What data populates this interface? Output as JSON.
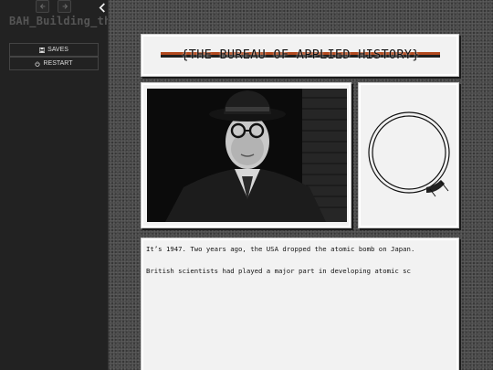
{
  "sidebar": {
    "title": "BAH_Building_the",
    "back_icon": "arrow-left-icon",
    "forward_icon": "arrow-right-icon",
    "collapse_icon": "chevron-left-icon",
    "buttons": {
      "saves": {
        "label": "SAVES",
        "icon": "floppy-disk-icon"
      },
      "restart": {
        "label": "RESTART",
        "icon": "power-icon"
      }
    }
  },
  "header": {
    "banner_text": "{THE BUREAU OF APPLIED HISTORY}",
    "banner_colors": {
      "band_top": "#b24a1f",
      "band_bottom": "#1f1f1f"
    }
  },
  "media": {
    "photo_icon": "portrait-photo",
    "emblem_icon": "ouroboros-icon"
  },
  "story": {
    "line_1": "It’s 1947. Two years ago, the USA dropped the atomic bomb on Japan.",
    "line_2": "British scientists had played a major part in developing atomic sc"
  }
}
